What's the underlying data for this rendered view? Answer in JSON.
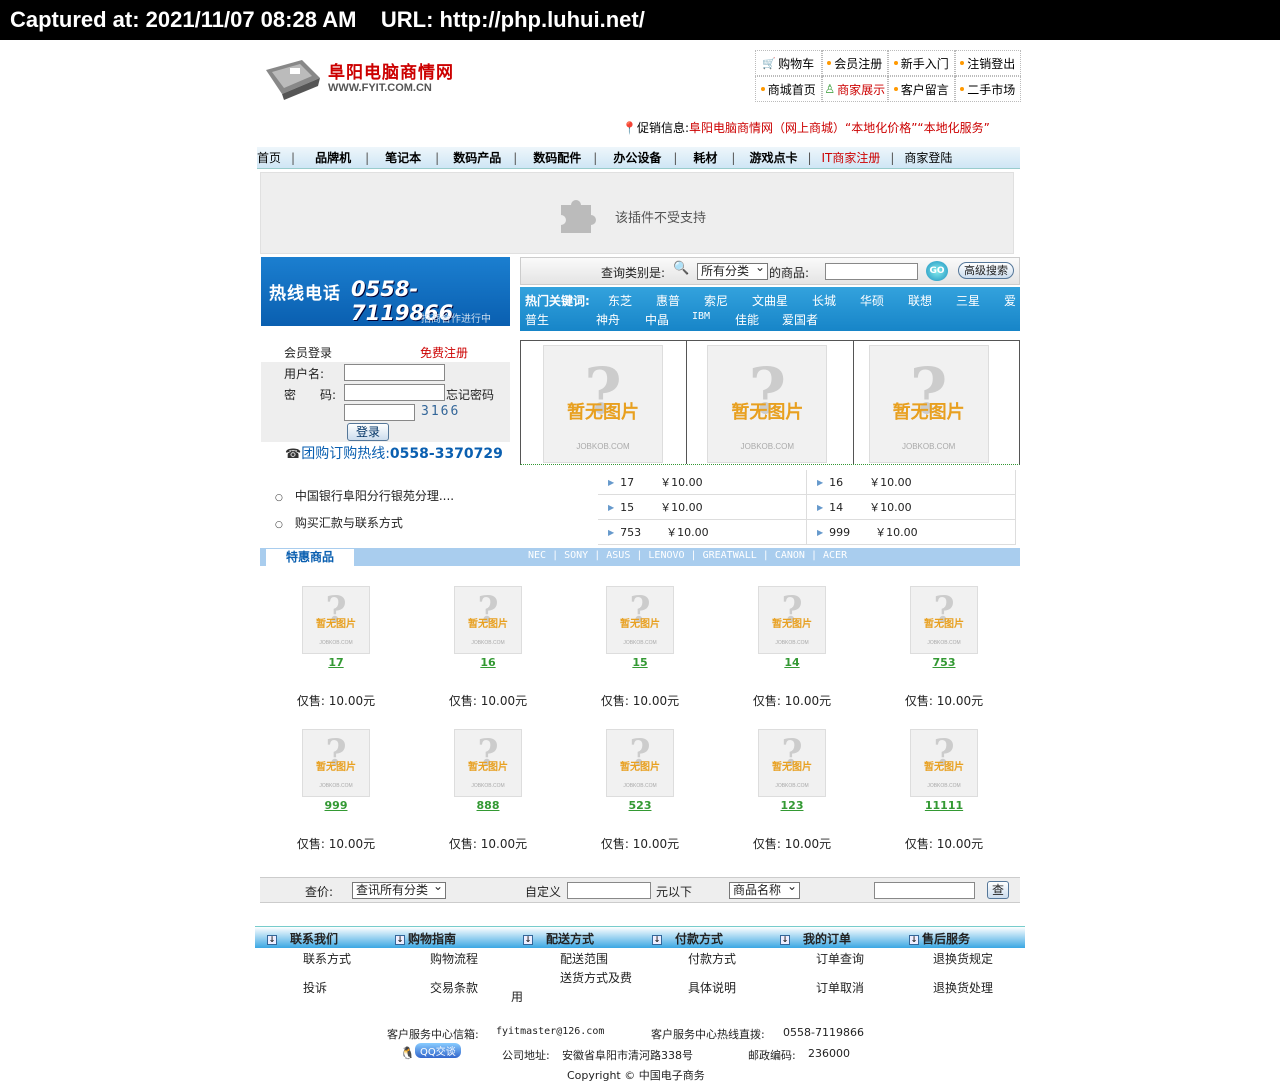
{
  "capture": {
    "text": "Captured at: 2021/11/07 08:28 AM    URL: http://php.luhui.net/"
  },
  "logo": {
    "cn": "阜阳电脑商情网",
    "en": "WWW.FYIT.COM.CN"
  },
  "toplinks": [
    "购物车",
    "会员注册",
    "新手入门",
    "注销登出",
    "商城首页",
    "商家展示",
    "客户留言",
    "二手市场"
  ],
  "promo": {
    "label": "促销信息:",
    "text": "阜阳电脑商情网（网上商城）“本地化价格”“本地化服务”"
  },
  "mainnav": [
    "首页",
    "品牌机",
    "笔记本",
    "数码产品",
    "数码配件",
    "办公设备",
    "耗材",
    "游戏点卡",
    "IT商家注册",
    "商家登陆"
  ],
  "plugin": {
    "text": "该插件不受支持"
  },
  "hotline": {
    "label": "热线电话",
    "number": "0558-7119866",
    "sub": "招商合作进行中"
  },
  "search": {
    "label": "查询类别是:",
    "category": "所有分类",
    "goods_label": "的商品:",
    "go": "GO",
    "advanced": "高级搜索"
  },
  "hot_keywords": {
    "label": "热门关键词:",
    "row1": [
      "东芝",
      "惠普",
      "索尼",
      "文曲星",
      "长城",
      "华硕",
      "联想",
      "三星",
      "爱"
    ],
    "row2": [
      "普生",
      "神舟",
      "中晶",
      "IBM",
      "佳能",
      "爱国者"
    ]
  },
  "login": {
    "title": "会员登录",
    "register": "免费注册",
    "username_label": "用户名:",
    "password_label": "密　　码:",
    "forgot": "忘记密码",
    "captcha": "3166",
    "submit": "登录"
  },
  "tuangou": {
    "label": "团购订购热线:",
    "number": "0558-3370729"
  },
  "noimage": {
    "title": "暂无图片",
    "watermark": "JOBKOB.COM"
  },
  "notices": [
    "中国银行阜阳分行银苑分理....",
    "购买汇款与联系方式"
  ],
  "price_list": [
    {
      "name": "17",
      "price": "￥10.00"
    },
    {
      "name": "16",
      "price": "￥10.00"
    },
    {
      "name": "15",
      "price": "￥10.00"
    },
    {
      "name": "14",
      "price": "￥10.00"
    },
    {
      "name": "753",
      "price": "￥10.00"
    },
    {
      "name": "999",
      "price": "￥10.00"
    }
  ],
  "special": {
    "title": "特惠商品",
    "brands": "NEC | SONY | ASUS | LENOVO | GREATWALL | CANON | ACER"
  },
  "products": [
    {
      "name": "17",
      "price": "仅售: 10.00元"
    },
    {
      "name": "16",
      "price": "仅售: 10.00元"
    },
    {
      "name": "15",
      "price": "仅售: 10.00元"
    },
    {
      "name": "14",
      "price": "仅售: 10.00元"
    },
    {
      "name": "753",
      "price": "仅售: 10.00元"
    },
    {
      "name": "999",
      "price": "仅售: 10.00元"
    },
    {
      "name": "888",
      "price": "仅售: 10.00元"
    },
    {
      "name": "523",
      "price": "仅售: 10.00元"
    },
    {
      "name": "123",
      "price": "仅售: 10.00元"
    },
    {
      "name": "11111",
      "price": "仅售: 10.00元"
    }
  ],
  "query": {
    "label": "查价:",
    "category": "查讯所有分类",
    "custom": "自定义",
    "below": "元以下",
    "field": "商品名称",
    "submit": "查"
  },
  "footer_nav": [
    {
      "title": "联系我们",
      "links": [
        "联系方式",
        "投诉"
      ]
    },
    {
      "title": "购物指南",
      "links": [
        "购物流程",
        "交易条款"
      ]
    },
    {
      "title": "配送方式",
      "links": [
        "配送范围",
        "送货方式及费",
        "用"
      ]
    },
    {
      "title": "付款方式",
      "links": [
        "付款方式",
        "具体说明"
      ]
    },
    {
      "title": "我的订单",
      "links": [
        "订单查询",
        "订单取消"
      ]
    },
    {
      "title": "售后服务",
      "links": [
        "退换货规定",
        "退换货处理"
      ]
    }
  ],
  "bottom": {
    "mail_label": "客户服务中心信箱:",
    "mail": "fyitmaster@126.com",
    "hot_label": "客户服务中心热线直拨:",
    "hot": "0558-7119866",
    "qq": "QQ交谈",
    "addr_label": "公司地址:",
    "addr": "安徽省阜阳市清河路338号",
    "zip_label": "邮政编码:",
    "zip": "236000",
    "copyright": "Copyright © 中国电子商务"
  }
}
